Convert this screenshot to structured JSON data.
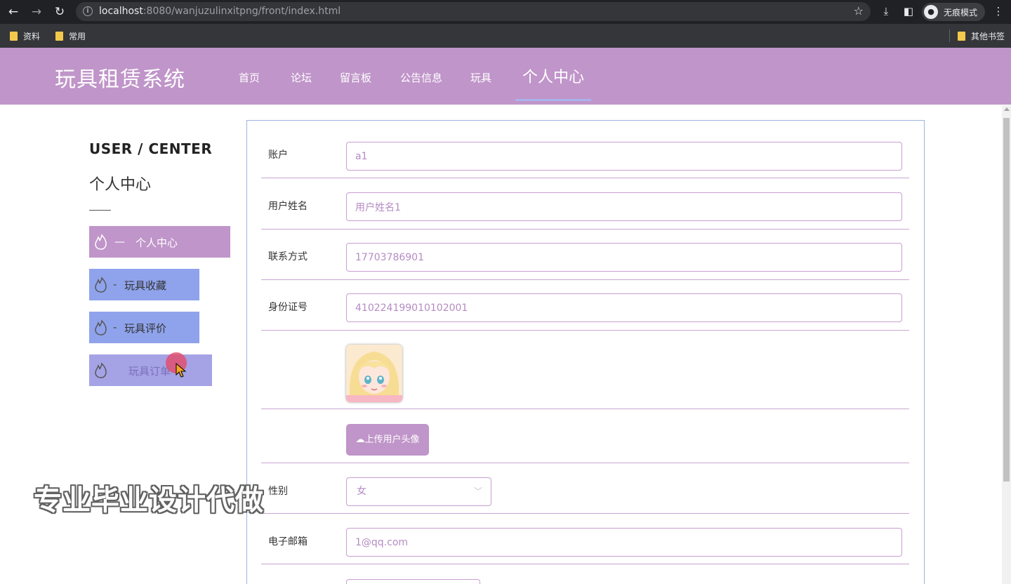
{
  "browser": {
    "url_host": "localhost",
    "url_rest": ":8080/wanjuzulinxitpng/front/index.html",
    "incognito_label": "无痕模式",
    "bookmarks": [
      "资料",
      "常用"
    ],
    "other_bookmarks": "其他书签"
  },
  "site": {
    "title": "玩具租赁系统",
    "nav": [
      "首页",
      "论坛",
      "留言板",
      "公告信息",
      "玩具",
      "个人中心"
    ],
    "active_nav": "个人中心",
    "accent_color": "#c095c9"
  },
  "sidebar": {
    "heading_en": "USER / CENTER",
    "heading_cn": "个人中心",
    "items": [
      {
        "prefix": "—",
        "label": "个人中心",
        "active": true
      },
      {
        "prefix": "-",
        "label": "玩具收藏",
        "active": false
      },
      {
        "prefix": "-",
        "label": "玩具评价",
        "active": false
      },
      {
        "prefix": "",
        "label": "玩具订单",
        "active": false
      }
    ]
  },
  "form": {
    "account": {
      "label": "账户",
      "value": "a1"
    },
    "name": {
      "label": "用户姓名",
      "value": "用户姓名1"
    },
    "phone": {
      "label": "联系方式",
      "value": "17703786901"
    },
    "id_card": {
      "label": "身份证号",
      "value": "410224199010102001"
    },
    "avatar_alt": "avatar-image",
    "upload_label": "上传用户头像",
    "gender": {
      "label": "性别",
      "value": "女"
    },
    "email": {
      "label": "电子邮箱",
      "value": "1@qq.com"
    }
  },
  "watermark": "专业毕业设计代做"
}
